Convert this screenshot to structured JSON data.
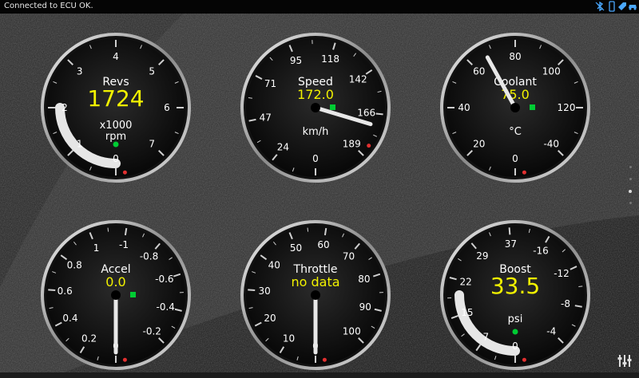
{
  "status_bar": {
    "message": "Connected to ECU OK.",
    "icons": [
      "bluetooth-off-icon",
      "phone-icon",
      "tag-icon",
      "car-icon"
    ],
    "icon_color": "#4aa8ff"
  },
  "colors": {
    "value": "#f2f200",
    "label": "#ffffff",
    "needle": "#e8e8e8",
    "indicator": "#00cc33",
    "warning": "#e23030"
  },
  "gauges": [
    {
      "id": "revs",
      "title": "Revs",
      "value": "1724",
      "units": "rpm",
      "multiplier": "x1000",
      "ticks": [
        "0",
        "1",
        "2",
        "3",
        "4",
        "5",
        "6",
        "7"
      ],
      "reading_fraction": 0.22,
      "arc": true,
      "indicator": "green-dot"
    },
    {
      "id": "speed",
      "title": "Speed",
      "value": "172.0",
      "units": "km/h",
      "ticks": [
        "0",
        "24",
        "47",
        "71",
        "95",
        "118",
        "142",
        "166",
        "189"
      ],
      "reading_fraction": 0.91,
      "arc": false,
      "indicator": "green-square"
    },
    {
      "id": "coolant",
      "title": "Coolant",
      "value": "75.0",
      "units": "°C",
      "ticks": [
        "0",
        "20",
        "40",
        "60",
        "80",
        "100",
        "120",
        "-40"
      ],
      "reading_fraction": 0.48,
      "arc": false,
      "indicator": "green-square"
    },
    {
      "id": "accel",
      "title": "Accel",
      "value": "0.0",
      "units": "",
      "ticks": [
        "0",
        "0.2",
        "0.4",
        "0.6",
        "0.8",
        "1",
        "-1",
        "-0.8",
        "-0.6",
        "-0.4",
        "-0.2"
      ],
      "reading_fraction": 0.0,
      "arc": false,
      "indicator": "green-square"
    },
    {
      "id": "throttle",
      "title": "Throttle",
      "value": "no data",
      "units": "",
      "ticks": [
        "0",
        "10",
        "20",
        "30",
        "40",
        "50",
        "60",
        "70",
        "80",
        "90",
        "100"
      ],
      "reading_fraction": 0.0,
      "arc": false,
      "indicator": "none"
    },
    {
      "id": "boost",
      "title": "Boost",
      "value": "33.5",
      "units": "psi",
      "ticks": [
        "0",
        "7",
        "15",
        "22",
        "29",
        "37",
        "-16",
        "-12",
        "-8",
        "-4"
      ],
      "reading_fraction": 0.56,
      "arc": true,
      "indicator": "green-dot"
    }
  ]
}
